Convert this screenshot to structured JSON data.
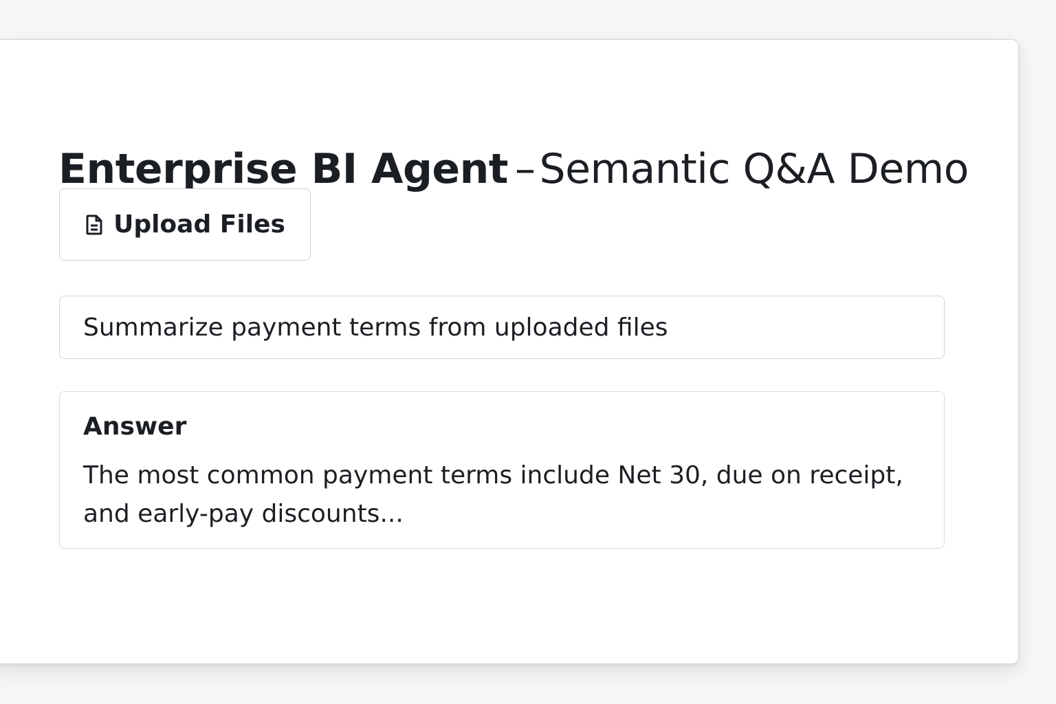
{
  "app": {
    "title_bold": "Enterprise BI Agent",
    "title_dash": "–",
    "title_rest": "Semantic Q&A Demo"
  },
  "upload": {
    "label": "Upload Files",
    "icon": "file-icon"
  },
  "query": {
    "value": "Summarize payment terms from uploaded files"
  },
  "answer": {
    "heading": "Answer",
    "text": "The most common payment terms include Net 30, due on receipt, and early-pay discounts..."
  },
  "colors": {
    "text": "#1b1f24",
    "border": "#cfd3d8",
    "card_bg": "#ffffff",
    "page_bg": "#f7f7f7"
  }
}
